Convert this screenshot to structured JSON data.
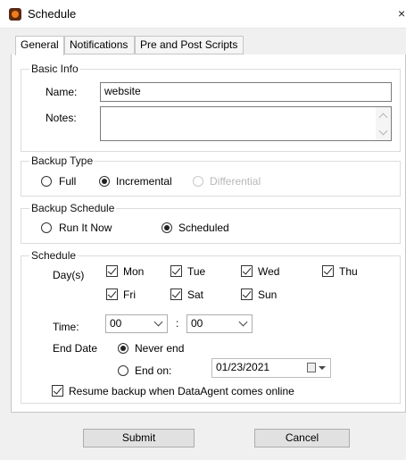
{
  "window": {
    "title": "Schedule",
    "close": "×"
  },
  "tabs": [
    {
      "label": "General"
    },
    {
      "label": "Notifications"
    },
    {
      "label": "Pre and Post Scripts"
    }
  ],
  "basic_info": {
    "legend": "Basic Info",
    "name_label": "Name:",
    "name_value": "website",
    "notes_label": "Notes:",
    "notes_value": ""
  },
  "backup_type": {
    "legend": "Backup Type",
    "options": [
      {
        "label": "Full",
        "selected": false,
        "enabled": true
      },
      {
        "label": "Incremental",
        "selected": true,
        "enabled": true
      },
      {
        "label": "Differential",
        "selected": false,
        "enabled": false
      }
    ]
  },
  "backup_schedule": {
    "legend": "Backup Schedule",
    "options": [
      {
        "label": "Run It Now",
        "selected": false
      },
      {
        "label": "Scheduled",
        "selected": true
      }
    ]
  },
  "schedule": {
    "legend": "Schedule",
    "days_label": "Day(s)",
    "days": [
      {
        "label": "Mon",
        "checked": true
      },
      {
        "label": "Tue",
        "checked": true
      },
      {
        "label": "Wed",
        "checked": true
      },
      {
        "label": "Thu",
        "checked": true
      },
      {
        "label": "Fri",
        "checked": true
      },
      {
        "label": "Sat",
        "checked": true
      },
      {
        "label": "Sun",
        "checked": true
      }
    ],
    "time_label": "Time:",
    "hour": "00",
    "minute": "00",
    "time_separator": ":",
    "end_date_label": "End Date",
    "end_options": [
      {
        "label": "Never end",
        "selected": true
      },
      {
        "label": "End on:",
        "selected": false
      }
    ],
    "end_on_date": "01/23/2021",
    "resume_label": "Resume backup when DataAgent comes online",
    "resume_checked": true
  },
  "buttons": {
    "submit": "Submit",
    "cancel": "Cancel"
  }
}
